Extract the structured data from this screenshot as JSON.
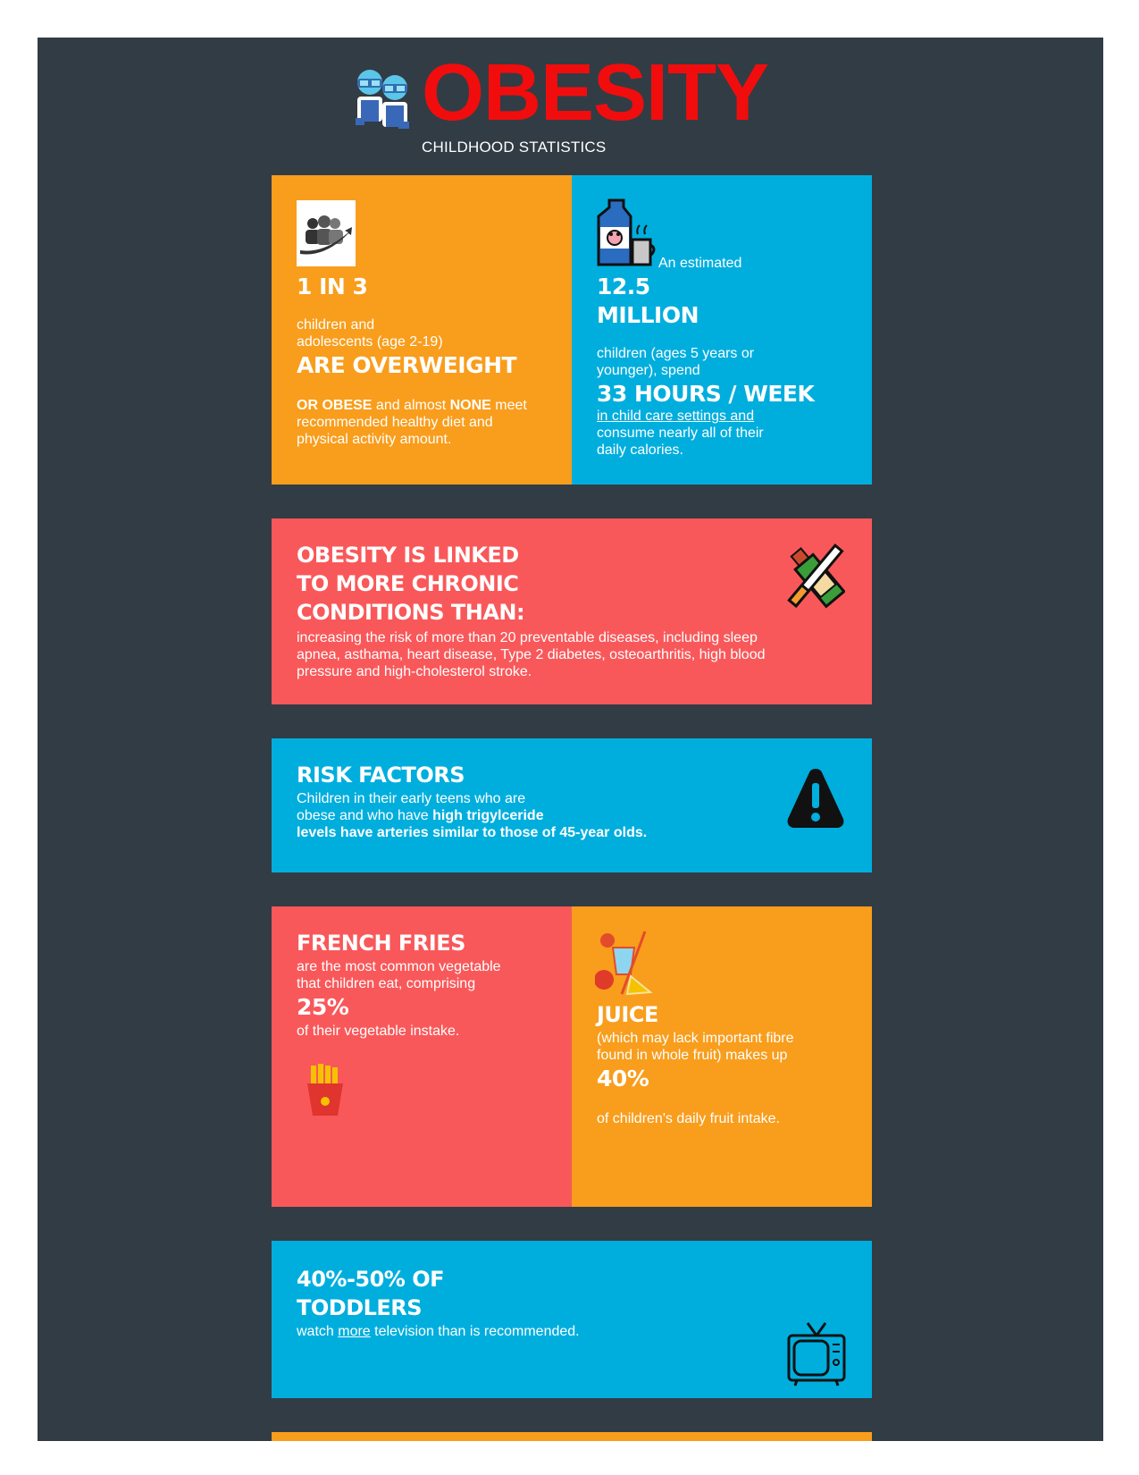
{
  "header": {
    "title": "OBESITY",
    "subtitle": "CHILDHOOD STATISTICS",
    "title_color": "#f10d0d",
    "icon": "children-icon"
  },
  "colors": {
    "background": "#323c45",
    "orange": "#f99d1c",
    "blue": "#00aede",
    "red": "#f9585a"
  },
  "card_overweight": {
    "icon": "family-trend-icon",
    "stat": "1 IN 3",
    "text1": "children and",
    "text2": "adolescents (age 2-19)",
    "headline": "ARE OVERWEIGHT",
    "or_obese": "OR OBESE",
    "text3": " and almost ",
    "none": "NONE",
    "text4": " meet",
    "text5": "recommended healthy diet and",
    "text6": "physical activity amount."
  },
  "card_childcare": {
    "icon": "milk-carton-icon",
    "intro": "An estimated",
    "stat1": "12.5",
    "stat2": "MILLION",
    "text1": "children (ages 5 years or",
    "text2": "younger), spend",
    "headline": "33 HOURS / WEEK",
    "underlined": "in child care settings and",
    "text3": "consume nearly all of their",
    "text4": "daily calories."
  },
  "card_chronic": {
    "icon": "no-smoking-drinking-icon",
    "heading1": "OBESITY IS LINKED",
    "heading2": "TO MORE CHRONIC",
    "heading3": "CONDITIONS THAN:",
    "text1": "increasing the risk of more than 20 preventable diseases, including sleep",
    "text2": "apnea, asthama, heart disease, Type 2 diabetes, osteoarthritis, high blood",
    "text3": "pressure and high-cholesterol stroke."
  },
  "card_risk": {
    "icon": "warning-icon",
    "heading": "RISK FACTORS",
    "text1": "Children in their early teens who are",
    "text2a": "obese and who have ",
    "text2b": "high trigylceride",
    "text3": "levels have arteries similar to those of 45-year olds."
  },
  "card_fries": {
    "icon": "french-fries-icon",
    "heading": "FRENCH FRIES",
    "text1": "are the most common vegetable",
    "text2": "that children eat, comprising",
    "stat": "25%",
    "text3": "of their vegetable instake."
  },
  "card_juice": {
    "icon": "juice-icon",
    "heading": "JUICE",
    "text1": "(which may lack important fibre",
    "text2": "found in whole fruit) makes up",
    "stat": "40%",
    "text3": "of children's daily fruit intake."
  },
  "card_toddlers": {
    "icon": "television-icon",
    "heading1": "40%-50% OF",
    "heading2": "TODDLERS",
    "text_a": "watch ",
    "text_u": "more",
    "text_b": " television than is recommended."
  }
}
